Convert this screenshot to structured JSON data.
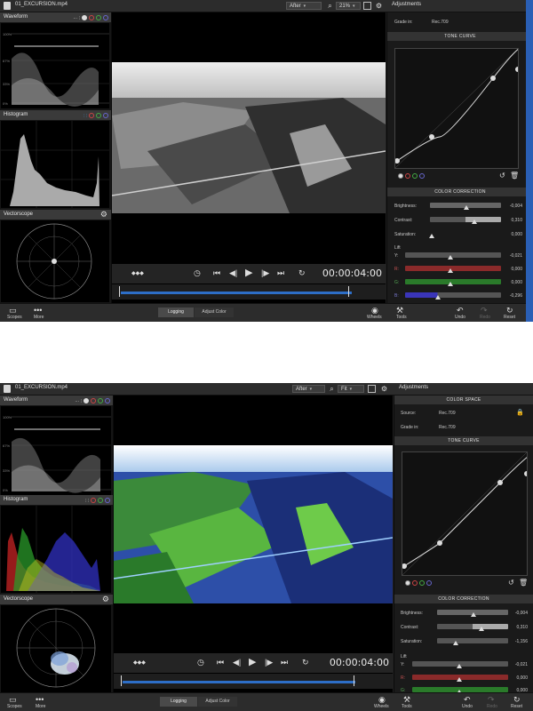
{
  "views": [
    {
      "id": "after",
      "window": {
        "file_name": "01_EXCURSION.mp4"
      },
      "toolbar": {
        "view_mode": "After",
        "zoom": "21%"
      },
      "scopes": {
        "waveform_title": "Waveform",
        "histogram_title": "Histogram",
        "vectorscope_title": "Vectorscope",
        "wave_labels": [
          "100%",
          "67%",
          "33%",
          "0%"
        ]
      },
      "adjustments": {
        "title": "Adjustments",
        "grade_in_label": "Grade in:",
        "grade_in_value": "Rec.709",
        "tone_curve_title": "TONE CURVE",
        "color_correction_title": "COLOR CORRECTION",
        "brightness_label": "Brightness:",
        "brightness_value": "-0,004",
        "contrast_label": "Contrast:",
        "contrast_value": "0,310",
        "saturation_label": "Saturation:",
        "saturation_value": "0,000",
        "lift_label": "Lift",
        "y_label": "Y:",
        "y_value": "-0,021",
        "r_label": "R:",
        "r_value": "0,000",
        "g_label": "G:",
        "g_value": "0,000",
        "b_label": "B:",
        "b_value": "-0,296"
      },
      "playback": {
        "timecode": "00:00:04:00",
        "progress": 0.93
      },
      "bottom": {
        "scopes": "Scopes",
        "more": "More",
        "logging": "Logging",
        "adjust_color": "Adjust Color",
        "wheels": "Wheels",
        "tools": "Tools",
        "undo": "Undo",
        "redo": "Redo",
        "reset": "Reset"
      }
    },
    {
      "id": "after-fit",
      "window": {
        "file_name": "01_EXCURSION.mp4"
      },
      "toolbar": {
        "view_mode": "After",
        "zoom": "Fit"
      },
      "scopes": {
        "waveform_title": "Waveform",
        "histogram_title": "Histogram",
        "vectorscope_title": "Vectorscope",
        "wave_labels": [
          "100%",
          "67%",
          "33%",
          "0%"
        ]
      },
      "adjustments": {
        "title": "Adjustments",
        "color_space_title": "COLOR SPACE",
        "source_label": "Source:",
        "source_value": "Rec.709",
        "grade_in_label": "Grade in:",
        "grade_in_value": "Rec.709",
        "tone_curve_title": "TONE CURVE",
        "color_correction_title": "COLOR CORRECTION",
        "brightness_label": "Brightness:",
        "brightness_value": "-0,004",
        "contrast_label": "Contrast:",
        "contrast_value": "0,310",
        "saturation_label": "Saturation:",
        "saturation_value": "-1,156",
        "lift_label": "Lift",
        "y_label": "Y:",
        "y_value": "-0,021",
        "r_label": "R:",
        "r_value": "0,000",
        "g_label": "G:",
        "g_value": "0,000"
      },
      "playback": {
        "timecode": "00:00:04:00",
        "progress": 0.93
      },
      "bottom": {
        "scopes": "Scopes",
        "more": "More",
        "logging": "Logging",
        "adjust_color": "Adjust Color",
        "wheels": "Wheels",
        "tools": "Tools",
        "undo": "Undo",
        "redo": "Redo",
        "reset": "Reset"
      }
    }
  ],
  "colors": {
    "accent": "#2d6ec7",
    "red": "#b02a2a",
    "green": "#2e8b2e",
    "blue": "#3a35b8"
  },
  "icons": [
    "document-icon",
    "compare-icon",
    "zoom-icon",
    "fullscreen-icon",
    "gear-icon",
    "lock-icon",
    "play-icon",
    "loop-icon",
    "undo-icon",
    "redo-icon",
    "reset-icon",
    "wheels-icon",
    "tools-icon",
    "scopes-icon",
    "more-icon"
  ]
}
